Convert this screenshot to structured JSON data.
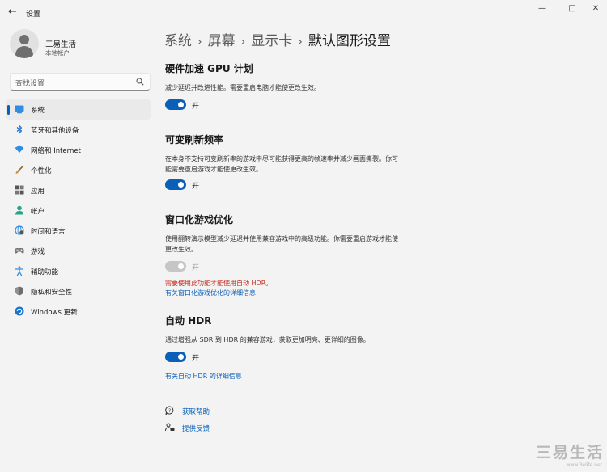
{
  "window": {
    "title": "设置",
    "back_glyph": "←",
    "minimize_glyph": "—",
    "maximize_glyph": "□",
    "close_glyph": "✕"
  },
  "user": {
    "name": "三易生活",
    "account_type": "本地帐户"
  },
  "search": {
    "placeholder": "查找设置"
  },
  "nav": [
    {
      "label": "系统",
      "icon": "monitor-icon",
      "active": true
    },
    {
      "label": "蓝牙和其他设备",
      "icon": "bluetooth-icon"
    },
    {
      "label": "网络和 Internet",
      "icon": "wifi-icon"
    },
    {
      "label": "个性化",
      "icon": "brush-icon"
    },
    {
      "label": "应用",
      "icon": "apps-icon"
    },
    {
      "label": "帐户",
      "icon": "person-icon"
    },
    {
      "label": "时间和语言",
      "icon": "globe-clock-icon"
    },
    {
      "label": "游戏",
      "icon": "gamepad-icon"
    },
    {
      "label": "辅助功能",
      "icon": "accessibility-icon"
    },
    {
      "label": "隐私和安全性",
      "icon": "shield-icon"
    },
    {
      "label": "Windows 更新",
      "icon": "update-icon"
    }
  ],
  "breadcrumb": {
    "items": [
      "系统",
      "屏幕",
      "显示卡"
    ],
    "separator": "›",
    "current": "默认图形设置"
  },
  "sections": {
    "gpu": {
      "title": "硬件加速 GPU 计划",
      "description": "减少延迟并改进性能。需要重启电脑才能使更改生效。",
      "toggle_label": "开",
      "on": true
    },
    "vrr": {
      "title": "可变刷新频率",
      "description": "在本身不支持可变刷新率的游戏中尽可能获得更高的帧速率并减少画面撕裂。你可能需要重启游戏才能使更改生效。",
      "toggle_label": "开",
      "on": true
    },
    "windowed": {
      "title": "窗口化游戏优化",
      "description": "使用翻转演示模型减少延迟并使用兼容游戏中的高级功能。你需要重启游戏才能使更改生效。",
      "toggle_label": "开",
      "on": true,
      "disabled": true,
      "warning": "需要使用此功能才能使用自动 HDR。",
      "link": "有关窗口化游戏优化的详细信息"
    },
    "hdr": {
      "title": "自动 HDR",
      "description": "通过增强从 SDR 到 HDR 的兼容游戏，获取更加明亮、更详细的图像。",
      "toggle_label": "开",
      "on": true,
      "link": "有关自动 HDR 的详细信息"
    }
  },
  "footer": {
    "get_help": "获取帮助",
    "feedback": "提供反馈"
  },
  "watermark": {
    "text": "三易生活",
    "url": "www.3elife.net"
  },
  "colors": {
    "accent": "#0a5fb8",
    "warning": "#c42b1c",
    "background": "#f3f3f3"
  }
}
